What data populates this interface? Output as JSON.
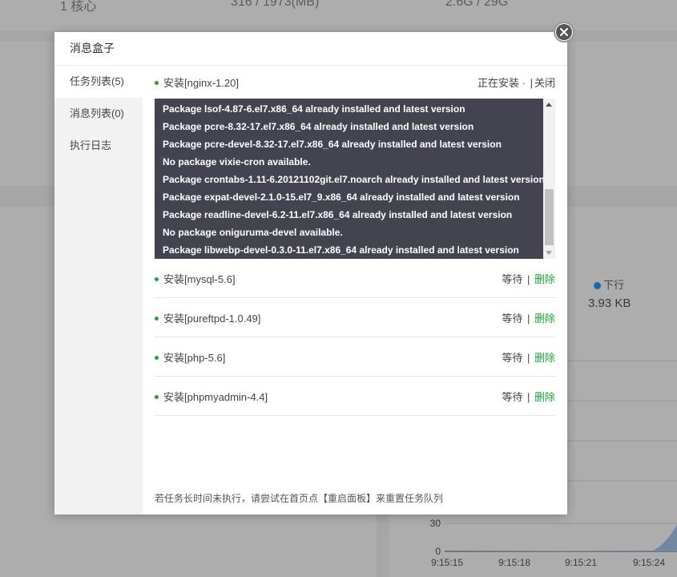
{
  "background": {
    "stats": [
      "1 核心",
      "316 / 1973(MB)",
      "2.6G / 29G"
    ],
    "net_legend": "下行",
    "net_value": "3.93 KB",
    "chart": {
      "y_ticks": [
        "30",
        "0"
      ],
      "x_ticks": [
        "9:15:15",
        "9:15:18",
        "9:15:21",
        "9:15:24"
      ]
    }
  },
  "dialog": {
    "title": "消息盒子",
    "side": [
      {
        "label": "任务列表(5)"
      },
      {
        "label": "消息列表(0)"
      },
      {
        "label": "执行日志"
      }
    ],
    "current_task": {
      "name": "安装[nginx-1.20]",
      "status": "正在安装 ·",
      "close_label": "关闭"
    },
    "log_lines": [
      "Package lsof-4.87-6.el7.x86_64 already installed and latest version",
      "Package pcre-8.32-17.el7.x86_64 already installed and latest version",
      "Package pcre-devel-8.32-17.el7.x86_64 already installed and latest version",
      "No package vixie-cron available.",
      "Package crontabs-1.11-6.20121102git.el7.noarch already installed and latest version",
      "Package expat-devel-2.1.0-15.el7_9.x86_64 already installed and latest version",
      "Package readline-devel-6.2-11.el7.x86_64 already installed and latest version",
      "No package oniguruma-devel available.",
      "Package libwebp-devel-0.3.0-11.el7.x86_64 already installed and latest version"
    ],
    "queued_tasks": [
      {
        "name": "安装[mysql-5.6]",
        "status": "等待",
        "delete": "删除"
      },
      {
        "name": "安装[pureftpd-1.0.49]",
        "status": "等待",
        "delete": "删除"
      },
      {
        "name": "安装[php-5.6]",
        "status": "等待",
        "delete": "删除"
      },
      {
        "name": "安装[phpmyadmin-4.4]",
        "status": "等待",
        "delete": "删除"
      }
    ],
    "footer_note": "若任务长时间未执行，请尝试在首页点【重启面板】来重置任务队列"
  },
  "colors": {
    "accent_green": "#20a53a",
    "log_bg": "#444450",
    "legend_blue": "#20a0ff"
  }
}
